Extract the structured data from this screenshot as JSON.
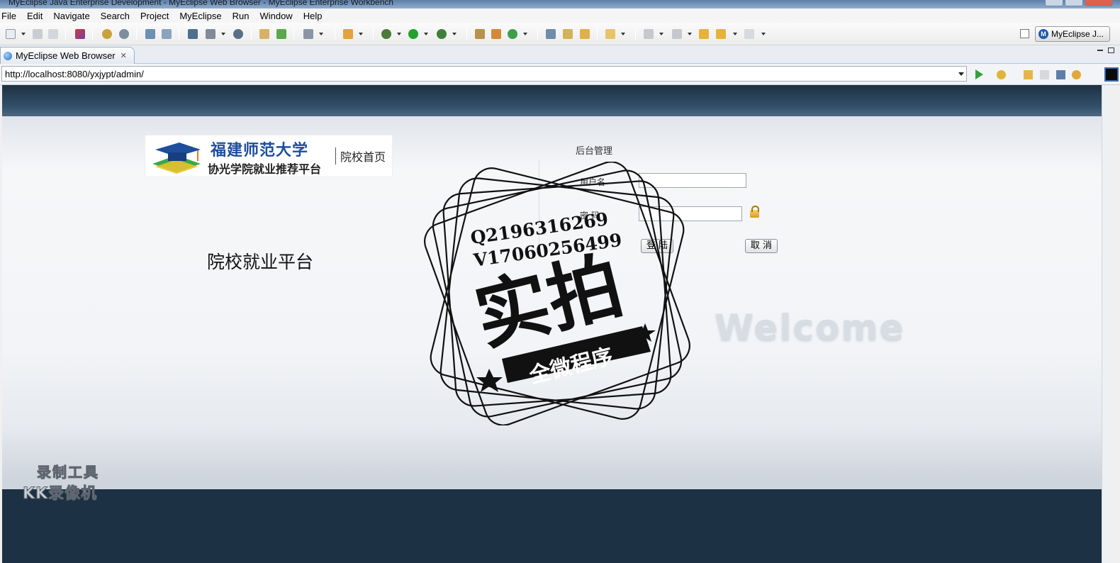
{
  "window": {
    "title": "MyEclipse Java Enterprise Development - MyEclipse Web Browser - MyEclipse Enterprise Workbench"
  },
  "menubar": {
    "items": [
      "File",
      "Edit",
      "Navigate",
      "Search",
      "Project",
      "MyEclipse",
      "Run",
      "Window",
      "Help"
    ]
  },
  "toolbar": {
    "perspective_label": "MyEclipse J..."
  },
  "editor_tab": {
    "label": "MyEclipse Web Browser"
  },
  "browser": {
    "url": "http://localhost:8080/yxjypt/admin/"
  },
  "page": {
    "logo": {
      "university": "福建师范大学",
      "college_and_platform": "协光学院就业推荐平台",
      "home_link": "院校首页"
    },
    "platform_title": "院校就业平台",
    "login": {
      "header": "后台管理",
      "username_label": "用户名",
      "password_label": "密 码",
      "login_button": "登 陆",
      "cancel_button": "取 消"
    },
    "welcome": "Welcome"
  },
  "watermarks": {
    "stamp_line1": "Q2196316269",
    "stamp_line2": "V17060256499",
    "stamp_big": "实拍",
    "stamp_banner": "全微程序",
    "recorder_line1": "录制工具",
    "recorder_line2": "KK录像机"
  },
  "colors": {
    "page_header": "#1d3142",
    "page_footer": "#1c3143",
    "logo_blue": "#1e4e9c",
    "logo_orange": "#e87a14"
  }
}
